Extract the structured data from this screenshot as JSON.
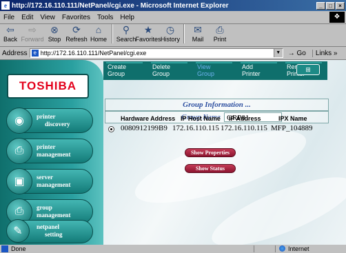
{
  "window": {
    "title": "http://172.16.110.111/NetPanel/cgi.exe - Microsoft Internet Explorer",
    "buttons": [
      "_",
      "□",
      "×"
    ]
  },
  "menu": [
    "File",
    "Edit",
    "View",
    "Favorites",
    "Tools",
    "Help"
  ],
  "toolbar": {
    "back": "Back",
    "forward": "Forward",
    "stop": "Stop",
    "refresh": "Refresh",
    "home": "Home",
    "search": "Search",
    "favorites": "Favorites",
    "history": "History",
    "mail": "Mail",
    "print": "Print"
  },
  "address": {
    "label": "Address",
    "url": "http://172.16.110.111/NetPanel/cgi.exe",
    "go": "Go",
    "links": "Links »"
  },
  "brand": {
    "logo": "TOSHIBA"
  },
  "tabs": [
    {
      "line1": "Create",
      "line2": "Group",
      "active": false
    },
    {
      "line1": "Delete",
      "line2": "Group",
      "active": false
    },
    {
      "line1": "View",
      "line2": "Group",
      "active": true
    },
    {
      "line1": "Add",
      "line2": "Printer",
      "active": false
    },
    {
      "line1": "Remove",
      "line2": "Printer",
      "active": false
    }
  ],
  "nav": [
    {
      "line1": "printer",
      "line2": "discovery",
      "icon": "binoculars-icon"
    },
    {
      "line1": "printer",
      "line2": "management",
      "icon": "printer-icon"
    },
    {
      "line1": "server",
      "line2": "management",
      "icon": "server-icon"
    },
    {
      "line1": "group",
      "line2": "management",
      "icon": "group-printer-icon"
    },
    {
      "line1": "netpanel",
      "line2": "setting",
      "icon": "wrench-icon"
    }
  ],
  "group": {
    "info_title": "Group Information ...",
    "name_label": "Group Name",
    "name_value": "GRP01"
  },
  "table": {
    "headers": [
      "Hardware Address",
      "IP Host Name",
      "IP Address",
      "IPX Name"
    ],
    "rows": [
      {
        "selected": true,
        "cells": [
          "0080912199B9",
          "172.16.110.115",
          "172.16.110.115",
          "MFP_104889"
        ]
      }
    ]
  },
  "actions": {
    "show_properties": "Show Properties",
    "show_status": "Show Status"
  },
  "status": {
    "text": "Done",
    "zone": "Internet"
  },
  "colors": {
    "panel_teal": "#0f6f6c",
    "action_button": "#a8213f",
    "brand_red": "#e3001b"
  }
}
